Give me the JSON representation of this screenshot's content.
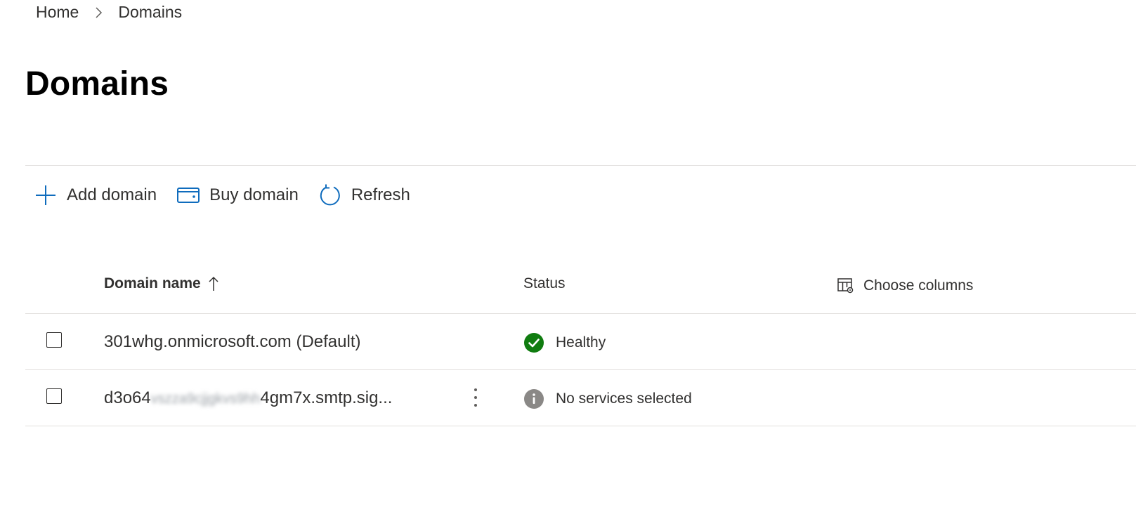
{
  "breadcrumb": {
    "home": "Home",
    "current": "Domains"
  },
  "page": {
    "title": "Domains"
  },
  "toolbar": {
    "add_label": "Add domain",
    "buy_label": "Buy domain",
    "refresh_label": "Refresh"
  },
  "table": {
    "columns": {
      "name": "Domain name",
      "status": "Status",
      "choose_columns": "Choose columns"
    },
    "rows": [
      {
        "name": "301whg.onmicrosoft.com (Default)",
        "status": "Healthy",
        "status_icon": "check-circle-icon"
      },
      {
        "name_prefix": "d3o64",
        "name_blurred": "vszza9cjjgkvs9hh",
        "name_suffix": "4gm7x.smtp.sig...",
        "status": "No services selected",
        "status_icon": "info-circle-icon"
      }
    ]
  },
  "colors": {
    "accent_blue": "#0f6cbd",
    "healthy_green": "#107c10",
    "info_gray": "#8a8886",
    "divider": "#e1dfdd"
  }
}
